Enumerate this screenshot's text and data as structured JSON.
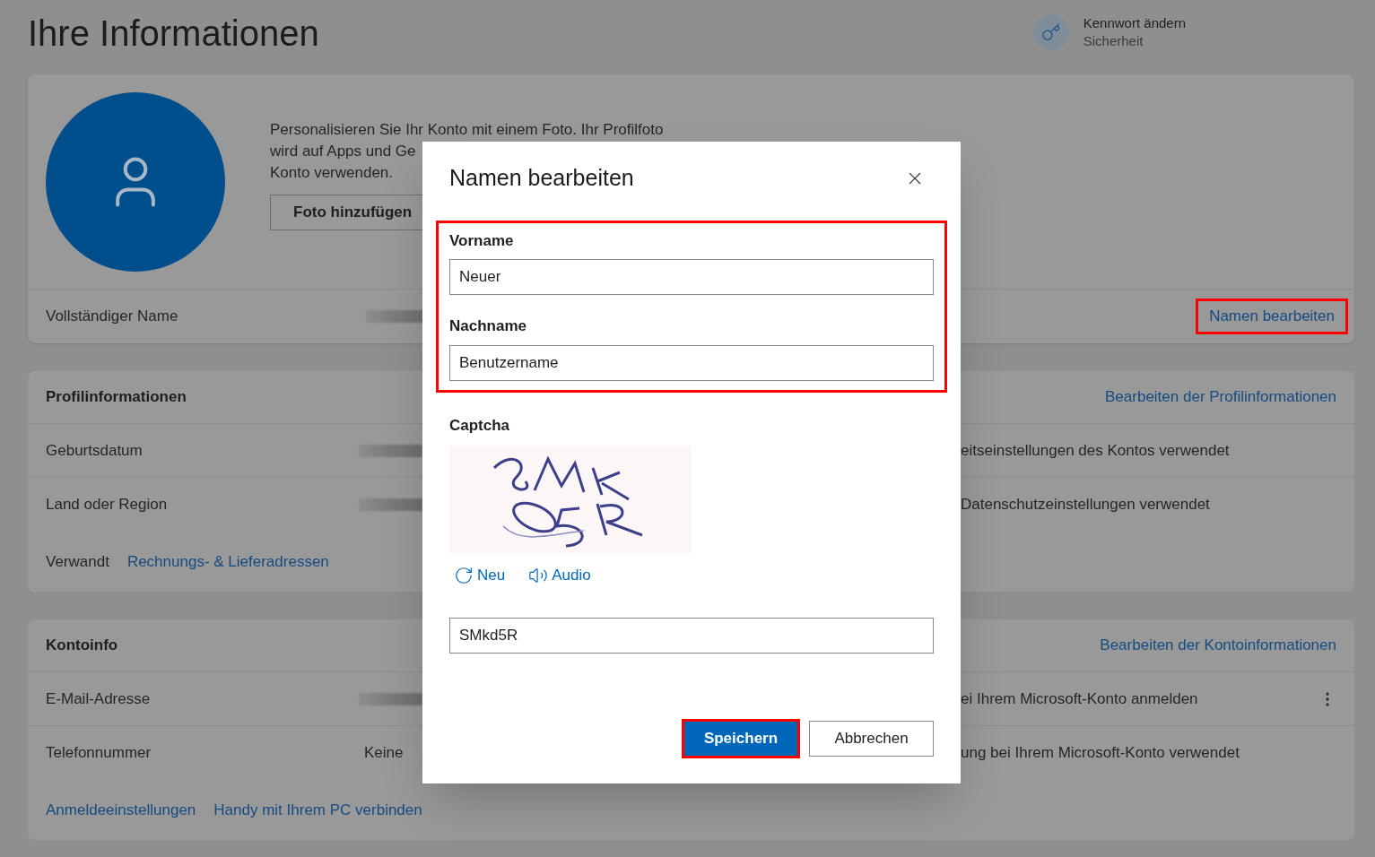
{
  "page_title": "Ihre Informationen",
  "password_link": {
    "title": "Kennwort ändern",
    "subtitle": "Sicherheit"
  },
  "profile_card": {
    "photo_text_lines": [
      "Personalisieren Sie Ihr Konto mit einem Foto. Ihr Profilfoto",
      "wird auf Apps und Ge",
      "Konto verwenden."
    ],
    "add_photo_button": "Foto hinzufügen",
    "full_name_label": "Vollständiger Name",
    "edit_name_link": {
      "label": "Namen bearbeiten",
      "highlighted": true
    }
  },
  "sections": [
    {
      "heading": "Profilinformationen",
      "edit_link": "Bearbeiten der Profilinformationen",
      "rows": [
        {
          "label": "Geburtsdatum",
          "kind": "blurred",
          "note": "eitseinstellungen des Kontos verwendet",
          "has_menu": false
        },
        {
          "label": "Land oder Region",
          "kind": "blurred",
          "note": "Datenschutzeinstellungen verwendet",
          "has_menu": false
        }
      ],
      "footer": {
        "label": "Verwandt",
        "links": [
          "Rechnungs- & Lieferadressen"
        ]
      }
    },
    {
      "heading": "Kontoinfo",
      "edit_link": "Bearbeiten der Kontoinformationen",
      "rows": [
        {
          "label": "E-Mail-Adresse",
          "kind": "blurred",
          "note": "ei Ihrem Microsoft-Konto anmelden",
          "has_menu": true
        },
        {
          "label": "Telefonnummer",
          "kind": "text",
          "value": "Keine",
          "note": "ung bei Ihrem Microsoft-Konto verwendet",
          "has_menu": false
        }
      ],
      "footer": {
        "links": [
          "Anmeldeeinstellungen",
          "Handy mit Ihrem PC verbinden"
        ]
      }
    }
  ],
  "dialog": {
    "title": "Namen bearbeiten",
    "name_fields": {
      "highlighted": true,
      "fields": [
        {
          "label": "Vorname",
          "value": "Neuer"
        },
        {
          "label": "Nachname",
          "value": "Benutzername"
        }
      ]
    },
    "captcha": {
      "label": "Captcha",
      "refresh": "Neu",
      "audio": "Audio",
      "value": "SMkd5R"
    },
    "buttons": [
      {
        "label": "Speichern",
        "kind": "primary",
        "highlighted": true
      },
      {
        "label": "Abbrechen",
        "kind": "secondary",
        "highlighted": false
      }
    ]
  }
}
